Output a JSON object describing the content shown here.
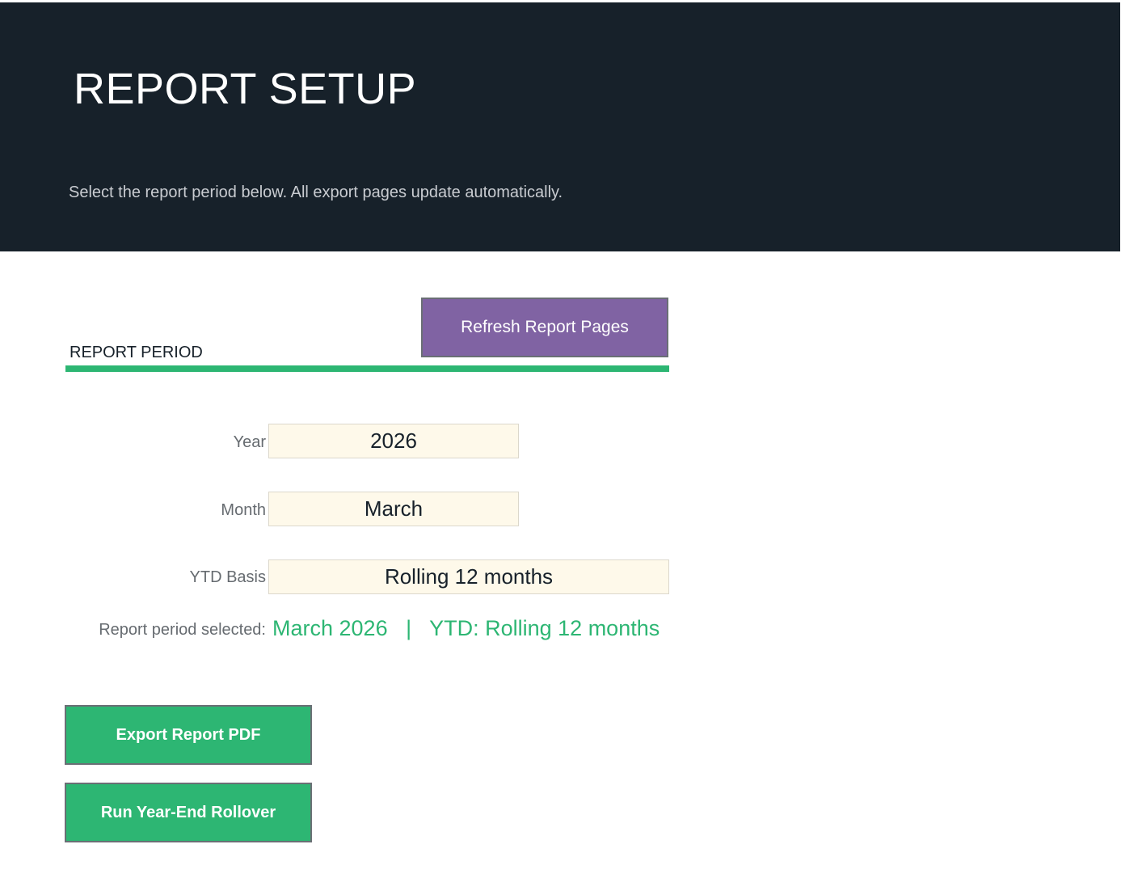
{
  "header": {
    "title": "REPORT SETUP",
    "subtitle": "Select the report period below. All export pages update automatically."
  },
  "actions": {
    "refresh_label": "Refresh Report Pages",
    "export_label": "Export Report PDF",
    "rollover_label": "Run Year-End Rollover"
  },
  "section": {
    "heading": "REPORT PERIOD"
  },
  "fields": {
    "year": {
      "label": "Year",
      "value": "2026"
    },
    "month": {
      "label": "Month",
      "value": "March"
    },
    "ytd_basis": {
      "label": "YTD Basis",
      "value": "Rolling 12 months"
    }
  },
  "summary": {
    "label": "Report period selected:",
    "value": "March 2026   |   YTD: Rolling 12 months"
  },
  "colors": {
    "header_bg": "#17212a",
    "accent_green": "#2db673",
    "accent_purple": "#8063a3",
    "input_bg": "#fef9ea"
  }
}
